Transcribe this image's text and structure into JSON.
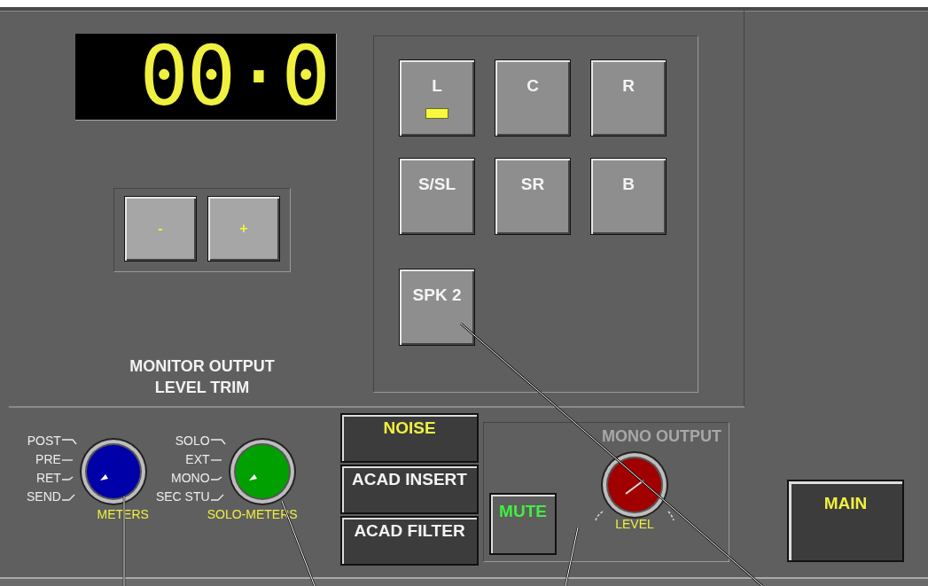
{
  "display": {
    "reading": "00·0"
  },
  "trim": {
    "buttons": [
      "-",
      "+"
    ],
    "caption": [
      "MONITOR OUTPUT",
      "LEVEL TRIM"
    ]
  },
  "speakers": [
    {
      "label": "L",
      "selected": true
    },
    {
      "label": "C",
      "selected": false
    },
    {
      "label": "R",
      "selected": false
    },
    {
      "label": "S/SL",
      "selected": false
    },
    {
      "label": "SR",
      "selected": false
    },
    {
      "label": "B",
      "selected": false
    },
    {
      "label": "SPK 2",
      "selected": false
    }
  ],
  "selectors": [
    {
      "label": "METERS",
      "color": "#0000a8",
      "positions": [
        "POST",
        "PRE",
        "RET",
        "SEND"
      ]
    },
    {
      "label": "SOLO-METERS",
      "color": "#00a000",
      "positions": [
        "SOLO",
        "EXT",
        "MONO",
        "SEC STU"
      ]
    }
  ],
  "sources": [
    {
      "label": "NOISE",
      "selected": true
    },
    {
      "label": "ACAD INSERT",
      "selected": false
    },
    {
      "label": "ACAD FILTER",
      "selected": false
    }
  ],
  "mono_output": {
    "title": "MONO OUTPUT",
    "mute": {
      "label": "MUTE",
      "on": true
    },
    "knob_label": "LEVEL"
  },
  "main_button": {
    "label": "MAIN"
  }
}
